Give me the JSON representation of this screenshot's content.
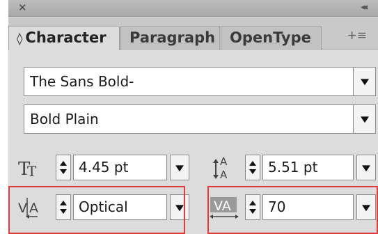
{
  "panel": {
    "close_glyph": "✕",
    "collapse_glyph": "◂◂",
    "menu_glyph": "+≡"
  },
  "tabs": [
    {
      "label": "Character",
      "active": true
    },
    {
      "label": "Paragraph",
      "active": false
    },
    {
      "label": "OpenType",
      "active": false
    }
  ],
  "font_family": {
    "value": "The Sans Bold-"
  },
  "font_style": {
    "value": "Bold Plain"
  },
  "font_size": {
    "value": "4.45 pt",
    "icon": "font-size-icon"
  },
  "leading": {
    "value": "5.51 pt",
    "icon": "leading-icon"
  },
  "kerning": {
    "value": "Optical",
    "icon": "kerning-icon"
  },
  "tracking": {
    "value": "70",
    "icon": "tracking-icon"
  },
  "colors": {
    "highlight": "#e03a3a",
    "panel_bg": "#dcdcdc"
  }
}
